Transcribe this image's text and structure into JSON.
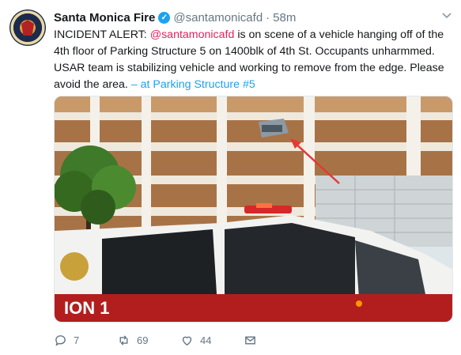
{
  "tweet": {
    "author_name": "Santa Monica Fire",
    "handle": "@santamonicafd",
    "separator": "·",
    "time": "58m",
    "text_prefix": "INCIDENT ALERT: ",
    "text_mention": "@santamonicafd",
    "text_body": " is on scene of a vehicle hanging off of the 4th floor of Parking Structure 5 on 1400blk of 4th St. Occupants unharmmed. USAR team is stabilizing vehicle and working to remove from the edge. Please avoid the area. ",
    "text_location": "– at Parking Structure #5",
    "avatar_text": "SANTA MONICA FIRE DEPARTMENT",
    "vehicle_lettering": "ION 1"
  },
  "actions": {
    "reply_count": "7",
    "retweet_count": "69",
    "like_count": "44"
  },
  "icons": [
    "verified-badge-icon",
    "caret-down-icon",
    "reply-icon",
    "retweet-icon",
    "like-icon",
    "direct-message-icon"
  ],
  "colors": {
    "mention": "#e0245e",
    "link": "#1da1f2",
    "secondary_text": "#657786",
    "verified": "#1da1f2"
  }
}
